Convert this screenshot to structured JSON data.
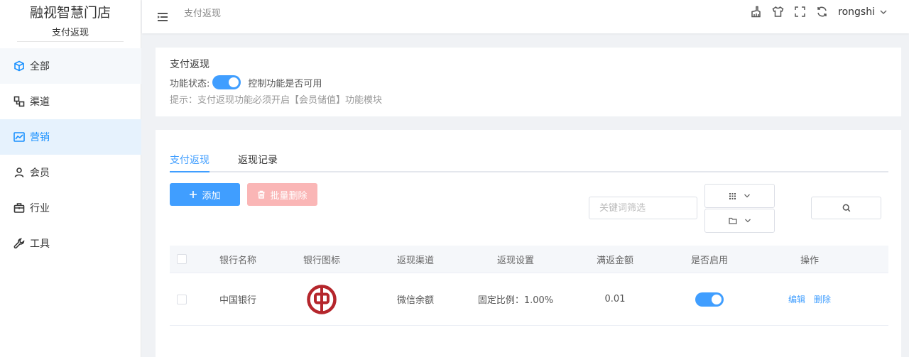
{
  "sidebar": {
    "brand": "融视智慧门店",
    "subtitle": "支付返现",
    "items": [
      {
        "label": "全部",
        "icon": "cube-icon"
      },
      {
        "label": "渠道",
        "icon": "channel-icon"
      },
      {
        "label": "营销",
        "icon": "trend-icon"
      },
      {
        "label": "会员",
        "icon": "user-icon"
      },
      {
        "label": "行业",
        "icon": "briefcase-icon"
      },
      {
        "label": "工具",
        "icon": "wrench-icon"
      }
    ],
    "active_index": 2
  },
  "topbar": {
    "breadcrumb": "支付返现",
    "username": "rongshi",
    "icons": [
      "brush-icon",
      "shirt-icon",
      "fullscreen-icon",
      "refresh-icon"
    ]
  },
  "feature": {
    "title": "支付返现",
    "status_label": "功能状态:",
    "status_enabled": true,
    "status_desc": "控制功能是否可用",
    "hint": "提示：支付返现功能必须开启【会员储值】功能模块"
  },
  "tabs": [
    "支付返现",
    "返现记录"
  ],
  "actions": {
    "add_label": "添加",
    "batch_delete_label": "批量删除",
    "search_placeholder": "关键词筛选"
  },
  "table": {
    "columns": [
      "银行名称",
      "银行图标",
      "返现渠道",
      "返现设置",
      "满返金额",
      "是否启用",
      "操作"
    ],
    "rows": [
      {
        "bank_name": "中国银行",
        "channel": "微信余额",
        "setting": "固定比例：1.00%",
        "amount": "0.01",
        "enabled": true,
        "edit_label": "编辑",
        "delete_label": "删除"
      }
    ]
  },
  "colors": {
    "primary": "#409eff",
    "danger_light": "#fab6b6",
    "bank_red": "#b5262c",
    "active_menu_bg": "#e6f2fd"
  }
}
